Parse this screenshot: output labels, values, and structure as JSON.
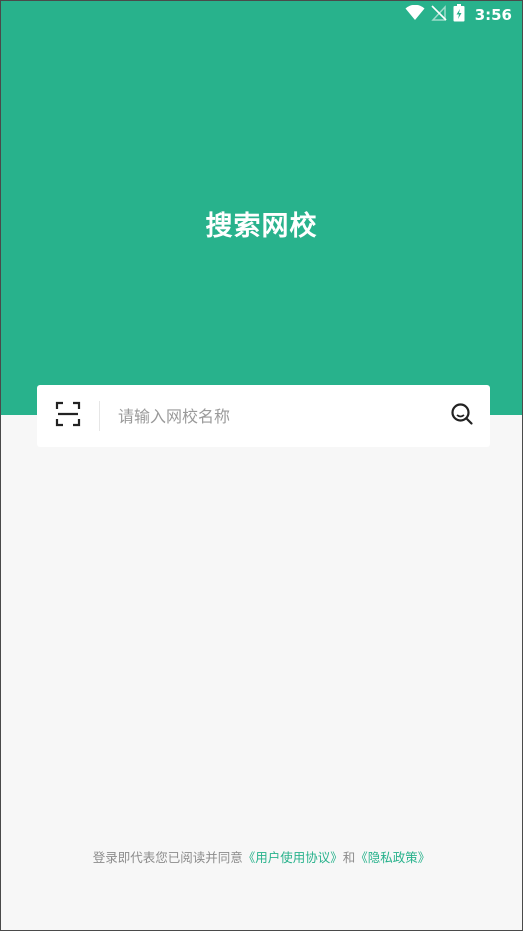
{
  "status_bar": {
    "time": "3:56",
    "icons": [
      "wifi-icon",
      "no-signal-icon",
      "battery-icon"
    ]
  },
  "header": {
    "title": "搜索网校"
  },
  "search": {
    "placeholder": "请输入网校名称",
    "value": "",
    "scan_icon": "scan-icon",
    "search_icon": "search-icon"
  },
  "footer": {
    "prefix": "登录即代表您已阅读并同意",
    "user_agreement": "《用户使用协议》",
    "conjunction": "和",
    "privacy_policy": "《隐私政策》"
  },
  "colors": {
    "brand": "#28b28c",
    "background": "#f7f7f7"
  }
}
